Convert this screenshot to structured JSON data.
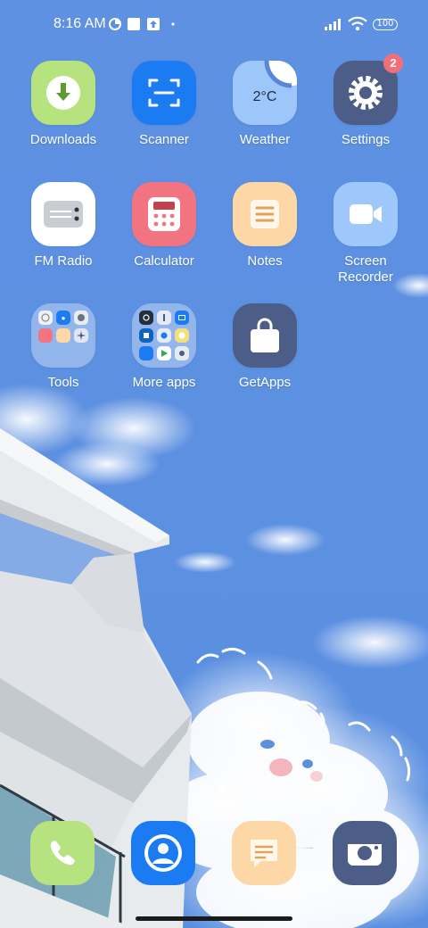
{
  "status_bar": {
    "time": "8:16 AM",
    "battery": "100"
  },
  "apps": [
    {
      "label": "Downloads",
      "icon": "download-arrow-icon"
    },
    {
      "label": "Scanner",
      "icon": "scan-frame-icon"
    },
    {
      "label": "Weather",
      "icon": "weather-icon",
      "temperature": "2°C"
    },
    {
      "label": "Settings",
      "icon": "gear-icon",
      "badge": "2"
    },
    {
      "label": "FM Radio",
      "icon": "radio-icon"
    },
    {
      "label": "Calculator",
      "icon": "calculator-icon"
    },
    {
      "label": "Notes",
      "icon": "notes-icon"
    },
    {
      "label": "Screen\nRecorder",
      "icon": "video-camera-icon"
    },
    {
      "label": "Tools",
      "icon": "folder-icon"
    },
    {
      "label": "More apps",
      "icon": "folder-icon"
    },
    {
      "label": "GetApps",
      "icon": "shopping-bag-icon"
    }
  ],
  "dock": [
    {
      "icon": "phone-icon"
    },
    {
      "icon": "contacts-icon"
    },
    {
      "icon": "messages-icon"
    },
    {
      "icon": "camera-icon"
    }
  ],
  "colors": {
    "sky": "#5b8fe0",
    "downloads": "#b3e07d",
    "scanner": "#1a7bf2",
    "weather": "#9cc6fb",
    "settings": "#4c5d88",
    "calculator": "#f27480",
    "notes": "#fdd7a5",
    "recorder": "#9ec8fc",
    "getapps": "#4c5d88"
  }
}
